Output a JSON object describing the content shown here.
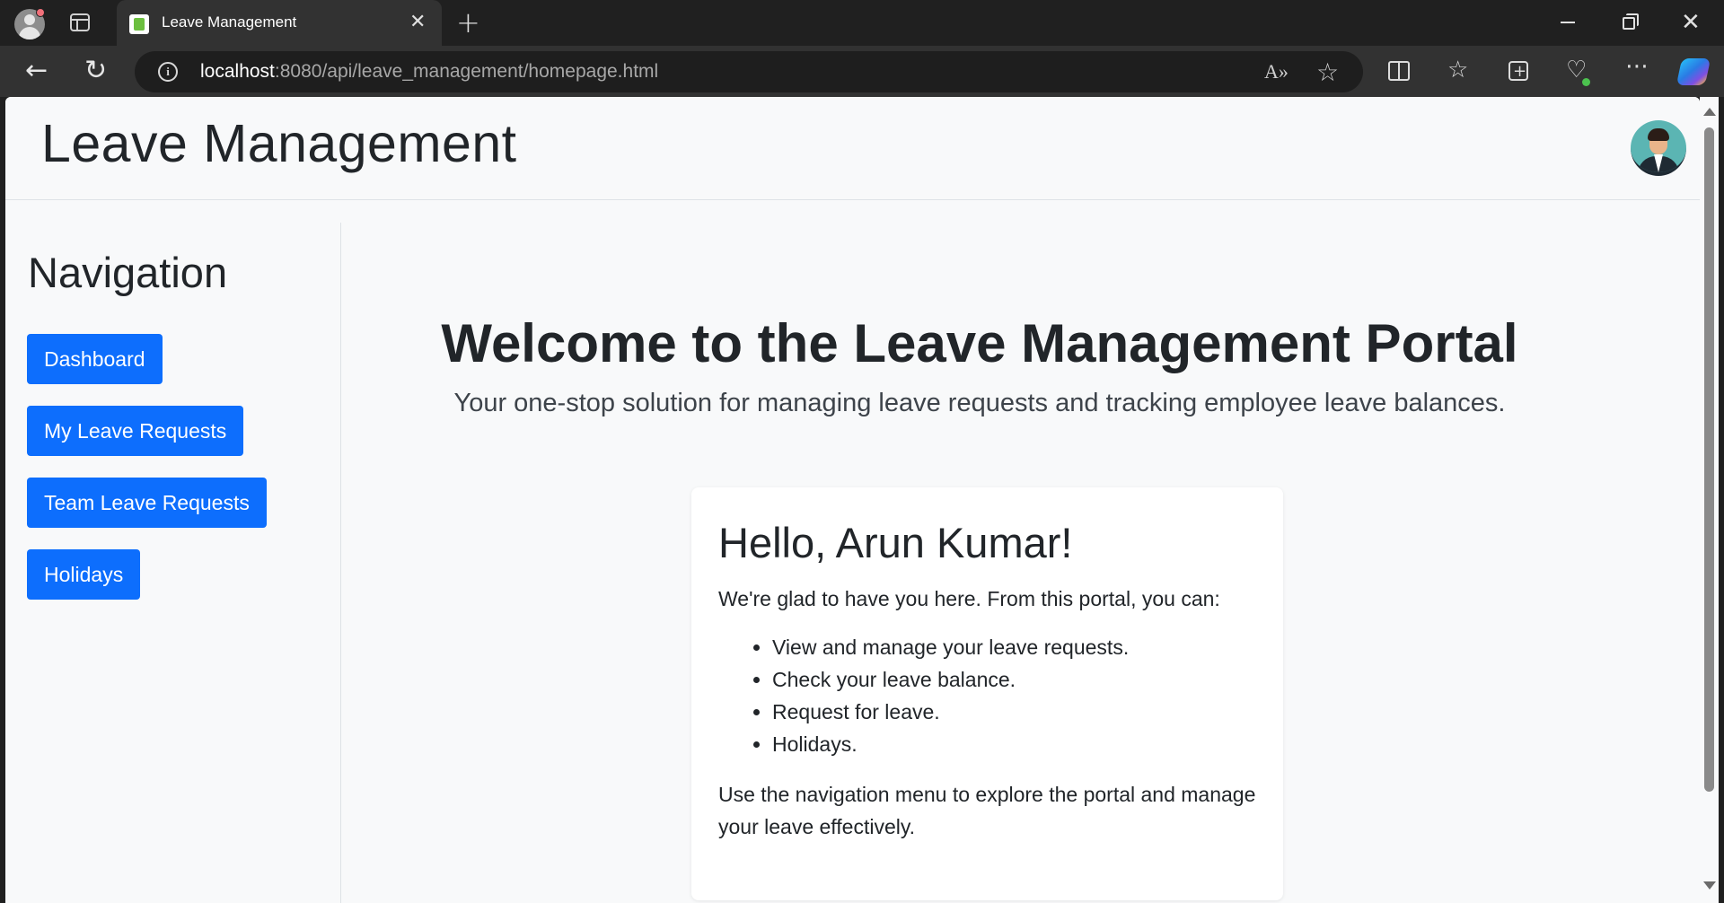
{
  "browser": {
    "tab_title": "Leave Management",
    "tab_close": "✕",
    "new_tab": "+",
    "url_host": "localhost",
    "url_path": ":8080/api/leave_management/homepage.html",
    "read_aloud": "A»",
    "more": "⋯",
    "icons": [
      "profile-icon",
      "tab-actions-icon",
      "favicon",
      "back-icon",
      "reload-icon",
      "info-icon",
      "read-aloud-icon",
      "favorite-star-icon",
      "split-screen-icon",
      "favorites-icon",
      "collections-icon",
      "browser-essentials-icon",
      "more-icon",
      "copilot-icon"
    ]
  },
  "header": {
    "title": "Leave Management",
    "avatar_icon": "user-avatar-icon"
  },
  "sidebar": {
    "title": "Navigation",
    "items": [
      {
        "label": "Dashboard"
      },
      {
        "label": "My Leave Requests"
      },
      {
        "label": "Team Leave Requests"
      },
      {
        "label": "Holidays"
      }
    ]
  },
  "main": {
    "heading": "Welcome to the Leave Management Portal",
    "lead": "Your one-stop solution for managing leave requests and tracking employee leave balances.",
    "card": {
      "title": "Hello, Arun Kumar!",
      "intro": "We're glad to have you here. From this portal, you can:",
      "features": [
        "View and manage your leave requests.",
        "Check your leave balance.",
        "Request for leave.",
        "Holidays."
      ],
      "outro": "Use the navigation menu to explore the portal and manage your leave effectively."
    }
  },
  "colors": {
    "primary": "#0d6efd",
    "page_bg": "#f8f9fa",
    "text": "#212529",
    "chrome_bg": "#202020"
  }
}
